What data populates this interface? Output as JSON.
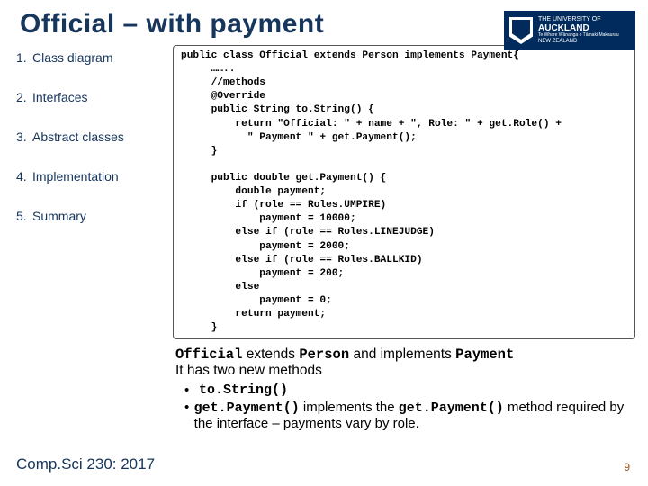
{
  "title": "Official – with payment",
  "logo": {
    "line1": "THE UNIVERSITY OF",
    "line2": "AUCKLAND",
    "line3": "Te Whare Wānanga o Tāmaki Makaurau",
    "line4": "NEW ZEALAND"
  },
  "nav": [
    {
      "num": "1.",
      "label": "Class diagram"
    },
    {
      "num": "2.",
      "label": "Interfaces"
    },
    {
      "num": "3.",
      "label": "Abstract classes"
    },
    {
      "num": "4.",
      "label": "Implementation"
    },
    {
      "num": "5.",
      "label": "Summary"
    }
  ],
  "code": "public class Official extends Person implements Payment{\n     ……..\n     //methods\n     @Override\n     public String to.String() {\n         return \"Official: \" + name + \", Role: \" + get.Role() +\n           \" Payment \" + get.Payment();\n     }\n\n     public double get.Payment() {\n         double payment;\n         if (role == Roles.UMPIRE)\n             payment = 10000;\n         else if (role == Roles.LINEJUDGE)\n             payment = 2000;\n         else if (role == Roles.BALLKID)\n             payment = 200;\n         else\n             payment = 0;\n         return payment;\n     }",
  "desc": {
    "line1_a": "Official",
    "line1_b": " extends ",
    "line1_c": "Person",
    "line1_d": " and implements ",
    "line1_e": "Payment",
    "line2": "It has two new methods",
    "b1": "to.String()",
    "b2a": "get.Payment()",
    "b2b": " implements the ",
    "b2c": "get.Payment()",
    "b2d": " method required by the interface – payments vary by role."
  },
  "footer": "Comp.Sci 230: 2017",
  "page": "9"
}
